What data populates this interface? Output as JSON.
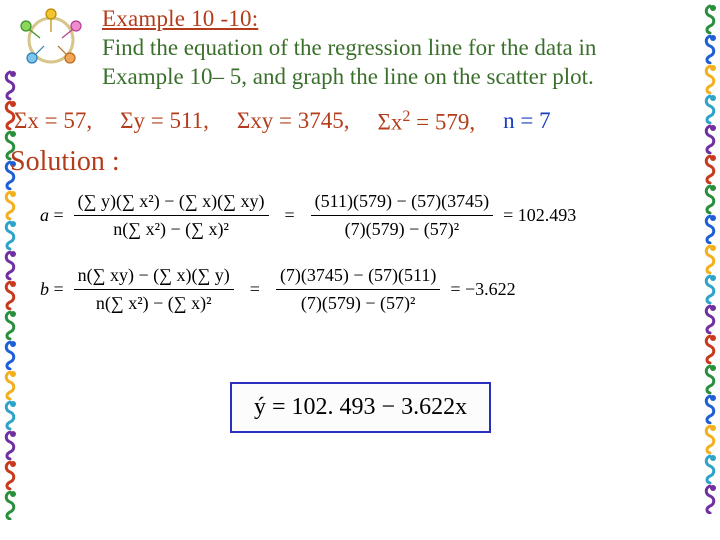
{
  "example": {
    "title": "Example 10 -10:",
    "prompt_line1": "Find the equation of the regression line for the data in",
    "prompt_line2": "Example 10– 5, and graph the line on the scatter plot."
  },
  "sums": {
    "sx": "Σx = 57,",
    "sy": "Σy = 511,",
    "sxy": "Σxy = 3745,",
    "sx2_pre": "Σx",
    "sx2_post": " = 579,",
    "n": "n = 7"
  },
  "solution_label": "Solution :",
  "formula_a": {
    "lhs": "a",
    "sym_num": "(∑ y)(∑ x²) − (∑ x)(∑ xy)",
    "sym_den": "n(∑ x²) − (∑ x)²",
    "num_num": "(511)(579) − (57)(3745)",
    "num_den": "(7)(579) − (57)²",
    "result": "= 102.493"
  },
  "formula_b": {
    "lhs": "b",
    "sym_num": "n(∑ xy) − (∑ x)(∑ y)",
    "sym_den": "n(∑ x²) − (∑ x)²",
    "num_num": "(7)(3745) − (57)(511)",
    "num_den": "(7)(579) − (57)²",
    "result": "= −3.622"
  },
  "final_equation": "ý = 102. 493 − 3.622x",
  "decor": {
    "colors": [
      "#7030a0",
      "#c73a1d",
      "#2a8f3d",
      "#1f5fd6",
      "#f2b01e",
      "#2ea3c9"
    ]
  }
}
